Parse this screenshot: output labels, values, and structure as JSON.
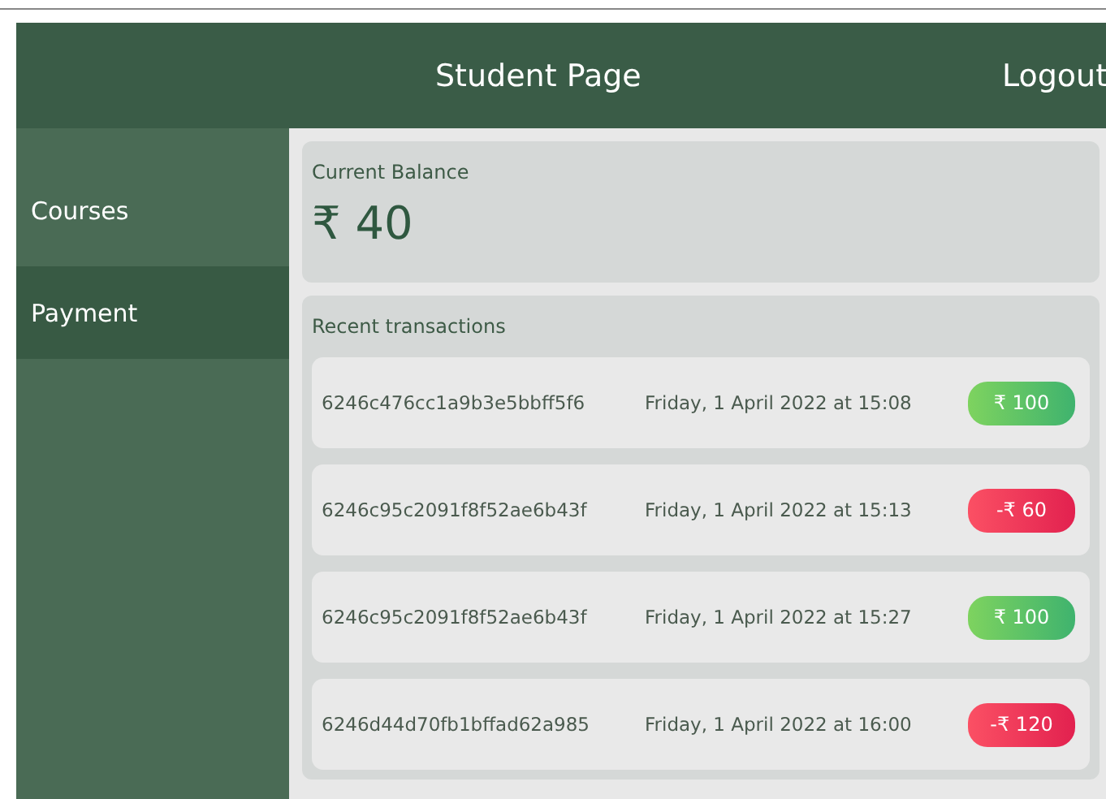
{
  "header": {
    "title": "Student Page",
    "logout": "Logout"
  },
  "sidebar": {
    "items": [
      {
        "label": "Courses",
        "selected": false
      },
      {
        "label": "Payment",
        "selected": true
      }
    ]
  },
  "balance": {
    "label": "Current Balance",
    "amount": "₹ 40"
  },
  "transactions": {
    "title": "Recent transactions",
    "rows": [
      {
        "id": "6246c476cc1a9b3e5bbff5f6",
        "date": "Friday, 1 April 2022 at 15:08",
        "amount": "₹ 100",
        "kind": "credit"
      },
      {
        "id": "6246c95c2091f8f52ae6b43f",
        "date": "Friday, 1 April 2022 at 15:13",
        "amount": "-₹ 60",
        "kind": "debit"
      },
      {
        "id": "6246c95c2091f8f52ae6b43f",
        "date": "Friday, 1 April 2022 at 15:27",
        "amount": "₹ 100",
        "kind": "credit"
      },
      {
        "id": "6246d44d70fb1bffad62a985",
        "date": "Friday, 1 April 2022 at 16:00",
        "amount": "-₹ 120",
        "kind": "debit"
      }
    ]
  }
}
